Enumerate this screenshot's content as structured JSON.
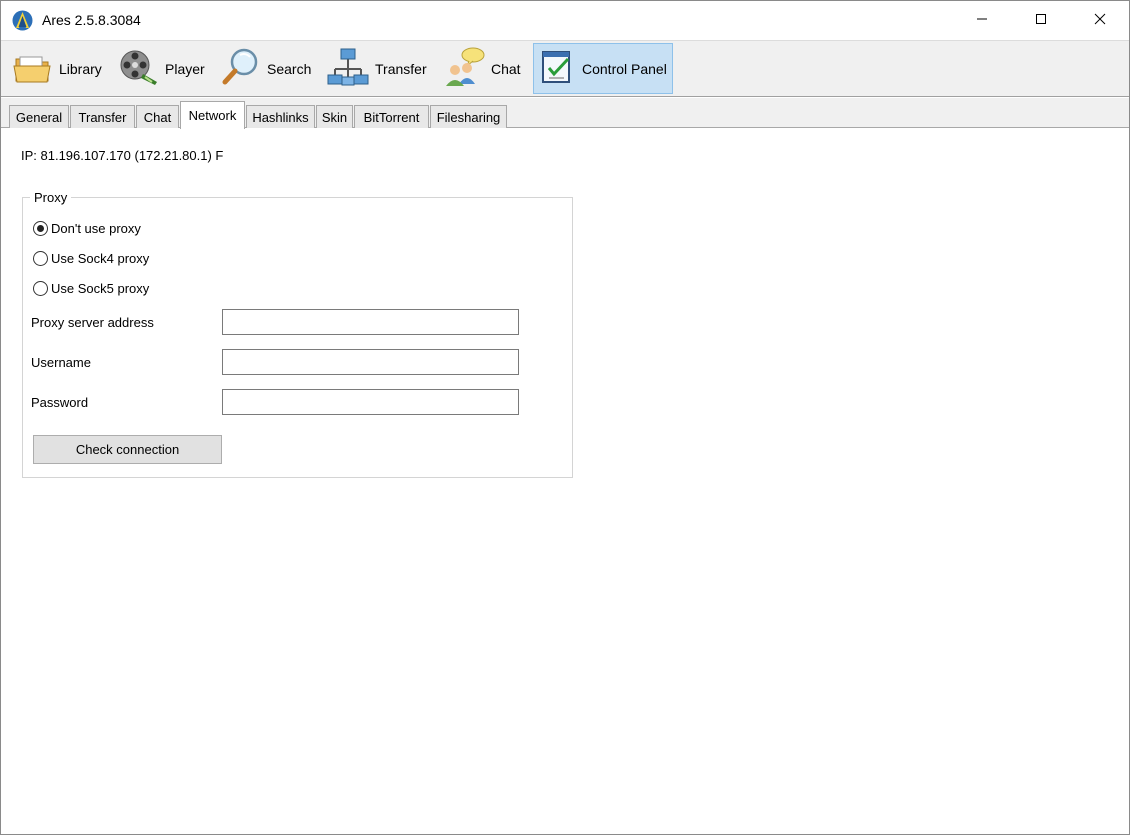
{
  "window": {
    "title": "Ares 2.5.8.3084",
    "controls": {
      "minimize": "minimize",
      "maximize": "maximize",
      "close": "close"
    }
  },
  "toolbar": {
    "items": [
      {
        "label": "Library",
        "icon": "folder-icon",
        "active": false
      },
      {
        "label": "Player",
        "icon": "film-reel-icon",
        "active": false
      },
      {
        "label": "Search",
        "icon": "magnifier-icon",
        "active": false
      },
      {
        "label": "Transfer",
        "icon": "network-icon",
        "active": false
      },
      {
        "label": "Chat",
        "icon": "chat-users-icon",
        "active": false
      },
      {
        "label": "Control Panel",
        "icon": "control-panel-icon",
        "active": true
      }
    ]
  },
  "tabs": {
    "items": [
      {
        "label": "General",
        "active": false
      },
      {
        "label": "Transfer",
        "active": false
      },
      {
        "label": "Chat",
        "active": false
      },
      {
        "label": "Network",
        "active": true
      },
      {
        "label": "Hashlinks",
        "active": false
      },
      {
        "label": "Skin",
        "active": false
      },
      {
        "label": "BitTorrent",
        "active": false
      },
      {
        "label": "Filesharing",
        "active": false
      }
    ]
  },
  "network": {
    "ip_text": "IP: 81.196.107.170 (172.21.80.1) F",
    "proxy": {
      "group_label": "Proxy",
      "options": [
        {
          "label": "Don't use proxy",
          "selected": true
        },
        {
          "label": "Use Sock4 proxy",
          "selected": false
        },
        {
          "label": "Use Sock5 proxy",
          "selected": false
        }
      ],
      "server_address_label": "Proxy server address",
      "server_address_value": "",
      "username_label": "Username",
      "username_value": "",
      "password_label": "Password",
      "password_value": "",
      "check_button_label": "Check connection"
    }
  },
  "colors": {
    "toolbar_bg": "#f0f0f0",
    "active_toolbar_bg": "#c7e0f4",
    "active_toolbar_border": "#8ec1ea"
  }
}
